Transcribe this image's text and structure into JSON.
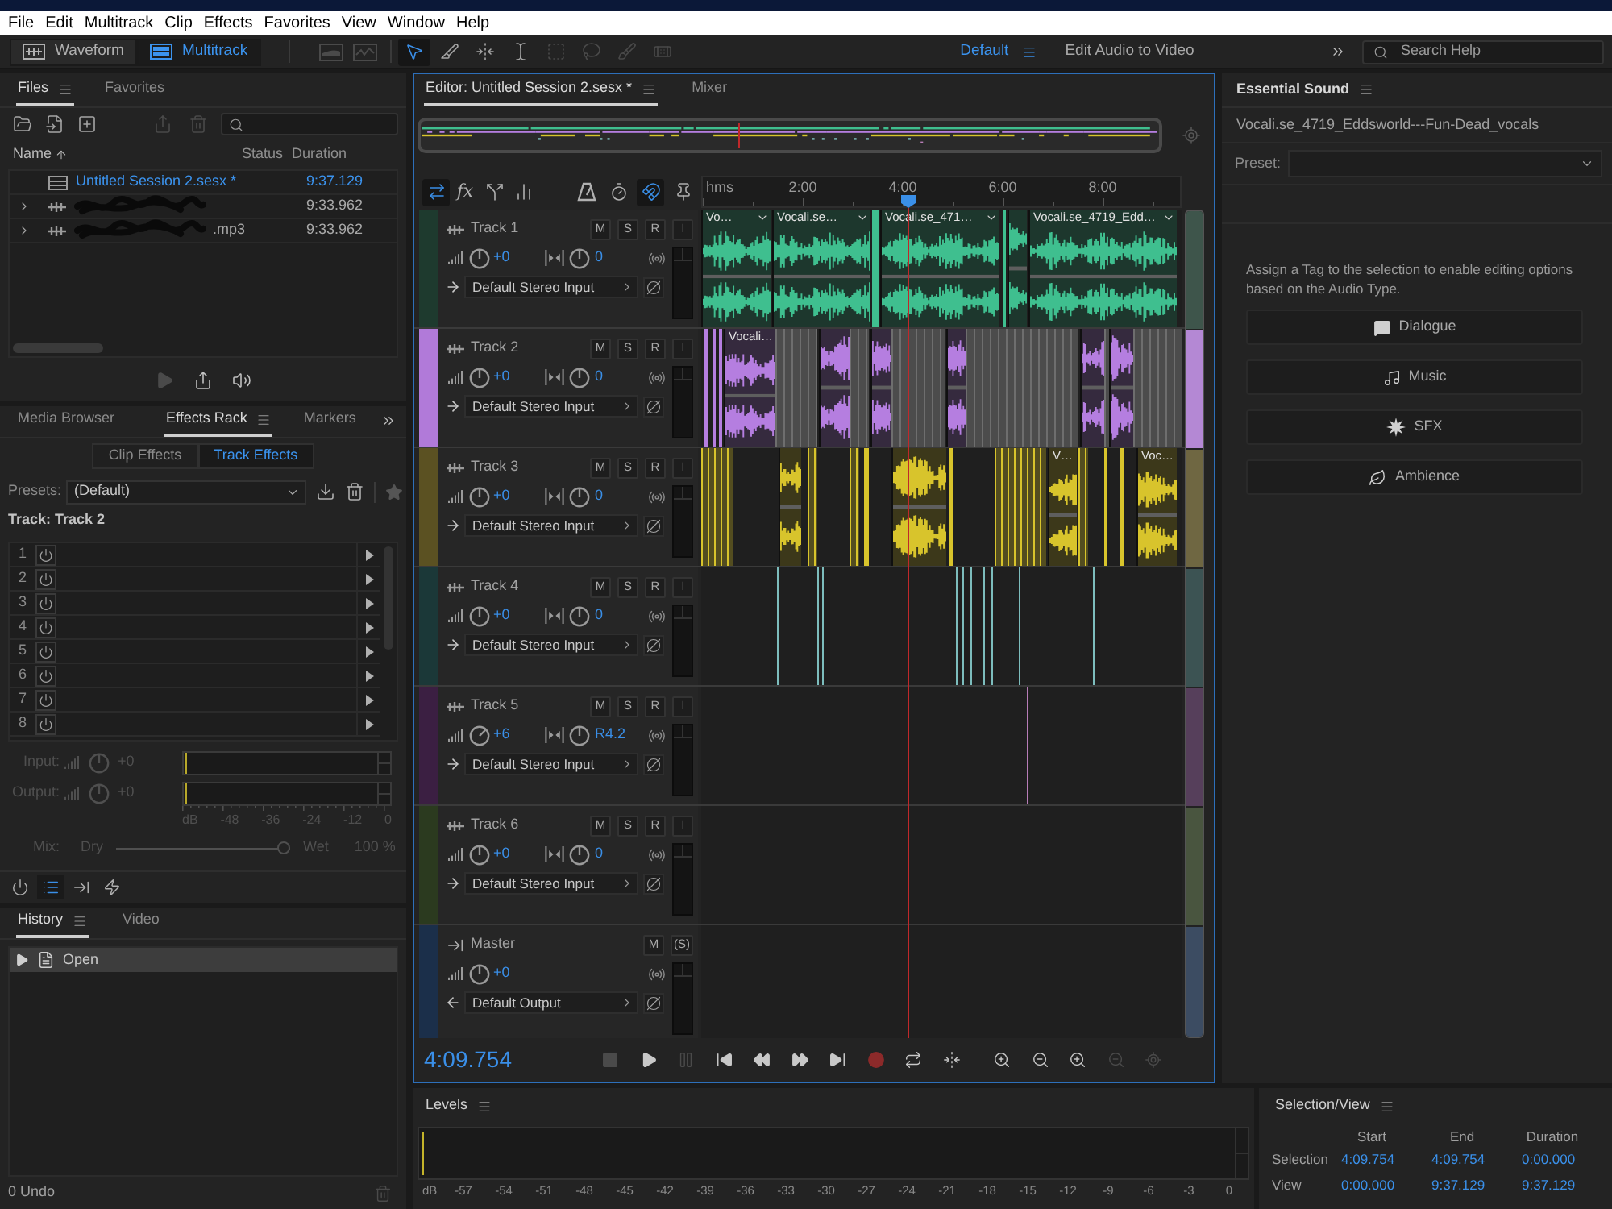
{
  "menu_bar": [
    "File",
    "Edit",
    "Multitrack",
    "Clip",
    "Effects",
    "Favorites",
    "View",
    "Window",
    "Help"
  ],
  "toolbar": {
    "views": [
      {
        "kind": "waveform",
        "label": "Waveform",
        "selected": false
      },
      {
        "kind": "multitrack",
        "label": "Multitrack",
        "selected": true
      }
    ],
    "display_tools": [
      {
        "kind": "spectral-frequency",
        "disabled": true
      },
      {
        "kind": "spectral-pitch",
        "disabled": true
      }
    ],
    "tools": [
      {
        "kind": "move",
        "selected": true,
        "disabled": false
      },
      {
        "kind": "razor",
        "selected": false,
        "disabled": false
      },
      {
        "kind": "slip",
        "selected": false,
        "disabled": false
      },
      {
        "kind": "time-selection",
        "selected": false,
        "disabled": false
      },
      {
        "kind": "marquee",
        "selected": false,
        "disabled": true
      },
      {
        "kind": "lasso",
        "selected": false,
        "disabled": true
      },
      {
        "kind": "brush",
        "selected": false,
        "disabled": true
      },
      {
        "kind": "healing",
        "selected": false,
        "disabled": true
      }
    ],
    "workspaces": [
      {
        "label": "Default",
        "selected": true
      },
      {
        "label": "Edit Audio to Video",
        "selected": false
      }
    ],
    "search": {
      "placeholder": "Search Help"
    }
  },
  "files_panel": {
    "tabs": [
      {
        "label": "Files",
        "selected": true
      },
      {
        "label": "Favorites",
        "selected": false
      }
    ],
    "tools": [
      {
        "kind": "open",
        "disabled": false
      },
      {
        "kind": "import",
        "disabled": false
      },
      {
        "kind": "new",
        "disabled": false
      },
      {
        "kind": "export",
        "disabled": true
      },
      {
        "kind": "delete",
        "disabled": true
      }
    ],
    "columns": [
      {
        "label": "Name",
        "sorted": true
      },
      {
        "label": "Status",
        "sorted": false
      },
      {
        "label": "Duration",
        "sorted": false
      }
    ],
    "rows": [
      {
        "kind": "session",
        "name": "Untitled Session 2.sesx *",
        "duration": "9:37.129",
        "open": true,
        "expandable": false,
        "redacted": false
      },
      {
        "kind": "audio",
        "duration": "9:33.962",
        "open": false,
        "expandable": true,
        "redacted": true
      },
      {
        "kind": "audio",
        "name": ".mp3",
        "duration": "9:33.962",
        "open": false,
        "expandable": true,
        "redacted": true
      }
    ],
    "footer_tools": [
      {
        "kind": "play",
        "disabled": true
      },
      {
        "kind": "export",
        "disabled": false
      },
      {
        "kind": "autoplay",
        "disabled": false
      }
    ]
  },
  "effects_rack": {
    "tabs": [
      {
        "label": "Media Browser",
        "selected": false
      },
      {
        "label": "Effects Rack",
        "selected": true
      },
      {
        "label": "Markers",
        "selected": false
      }
    ],
    "modes": [
      {
        "label": "Clip Effects",
        "selected": false
      },
      {
        "label": "Track Effects",
        "selected": true
      }
    ],
    "presets": {
      "label": "Presets:",
      "value": "(Default)"
    },
    "target": "Track: Track 2",
    "slots": [
      "1",
      "2",
      "3",
      "4",
      "5",
      "6",
      "7",
      "8"
    ],
    "io": {
      "disabled": true,
      "input": {
        "label": "Input:",
        "value": "+0"
      },
      "output": {
        "label": "Output:",
        "value": "+0"
      },
      "scale": [
        "dB",
        "-48",
        "-36",
        "-24",
        "-12",
        "0"
      ],
      "mix": {
        "label": "Mix:",
        "dry": "Dry",
        "wet": "Wet",
        "value": "100 %",
        "level": 1
      }
    },
    "footer_tools": [
      {
        "kind": "power",
        "selected": false
      },
      {
        "kind": "list",
        "selected": true
      },
      {
        "kind": "insert",
        "selected": false
      },
      {
        "kind": "process",
        "selected": false
      }
    ]
  },
  "history_panel": {
    "tabs": [
      {
        "label": "History",
        "selected": true
      },
      {
        "label": "Video",
        "selected": false
      }
    ],
    "items": [
      {
        "label": "Open",
        "selected": true
      }
    ],
    "status": "0 Undo"
  },
  "editor": {
    "tabs": [
      {
        "label": "Editor: Untitled Session 2.sesx *",
        "selected": true
      },
      {
        "label": "Mixer",
        "selected": false
      }
    ],
    "toolbar_left": [
      {
        "kind": "inputs-outputs",
        "selected": true
      },
      {
        "kind": "effects",
        "label": "fx",
        "selected": false
      },
      {
        "kind": "sends",
        "selected": false
      },
      {
        "kind": "eq",
        "selected": false
      }
    ],
    "toolbar_right": [
      {
        "kind": "metronome",
        "selected": false
      },
      {
        "kind": "time-stretch",
        "selected": false
      },
      {
        "kind": "snap",
        "selected": true
      },
      {
        "kind": "marker",
        "selected": false
      }
    ],
    "ruler": {
      "unit": "hms",
      "labels": [
        "2:00",
        "4:00",
        "6:00",
        "8:00"
      ]
    },
    "tracks": [
      {
        "kind": "audio",
        "name": "Track 1",
        "color": "#1e3a2e",
        "buttons": [
          {
            "label": "M",
            "disabled": false
          },
          {
            "label": "S",
            "disabled": false
          },
          {
            "label": "R",
            "disabled": false
          },
          {
            "label": "I",
            "disabled": true
          }
        ],
        "volume": {
          "value": "+0",
          "turned": false
        },
        "pan": {
          "value": "0",
          "turned": false
        },
        "io": "Default Stereo Input",
        "clips": [
          "Vo…",
          "Vocali.se…",
          "Vocali.se_471…",
          "Vocali.se_4719_Edd…"
        ]
      },
      {
        "kind": "audio",
        "name": "Track 2",
        "color": "#b17ad9",
        "buttons": [
          {
            "label": "M",
            "disabled": false
          },
          {
            "label": "S",
            "disabled": false
          },
          {
            "label": "R",
            "disabled": false
          },
          {
            "label": "I",
            "disabled": true
          }
        ],
        "volume": {
          "value": "+0",
          "turned": false
        },
        "pan": {
          "value": "0",
          "turned": false
        },
        "io": "Default Stereo Input",
        "clips": [
          "Vocali…"
        ]
      },
      {
        "kind": "audio",
        "name": "Track 3",
        "color": "#5b5122",
        "buttons": [
          {
            "label": "M",
            "disabled": false
          },
          {
            "label": "S",
            "disabled": false
          },
          {
            "label": "R",
            "disabled": false
          },
          {
            "label": "I",
            "disabled": true
          }
        ],
        "volume": {
          "value": "+0",
          "turned": false
        },
        "pan": {
          "value": "0",
          "turned": false
        },
        "io": "Default Stereo Input",
        "clips": [
          "V…",
          "Voc…"
        ]
      },
      {
        "kind": "audio",
        "name": "Track 4",
        "color": "#1b3838",
        "buttons": [
          {
            "label": "M",
            "disabled": false
          },
          {
            "label": "S",
            "disabled": false
          },
          {
            "label": "R",
            "disabled": false
          },
          {
            "label": "I",
            "disabled": true
          }
        ],
        "volume": {
          "value": "+0",
          "turned": false
        },
        "pan": {
          "value": "0",
          "turned": false
        },
        "io": "Default Stereo Input"
      },
      {
        "kind": "audio",
        "name": "Track 5",
        "color": "#3b1f42",
        "buttons": [
          {
            "label": "M",
            "disabled": false
          },
          {
            "label": "S",
            "disabled": false
          },
          {
            "label": "R",
            "disabled": false
          },
          {
            "label": "I",
            "disabled": true
          }
        ],
        "volume": {
          "value": "+6",
          "turned": true
        },
        "pan": {
          "value": "R4.2",
          "turned": false
        },
        "io": "Default Stereo Input"
      },
      {
        "kind": "audio",
        "name": "Track 6",
        "color": "#2b3a1f",
        "buttons": [
          {
            "label": "M",
            "disabled": false
          },
          {
            "label": "S",
            "disabled": false
          },
          {
            "label": "R",
            "disabled": false
          },
          {
            "label": "I",
            "disabled": true
          }
        ],
        "volume": {
          "value": "+0",
          "turned": false
        },
        "pan": {
          "value": "0",
          "turned": false
        },
        "io": "Default Stereo Input"
      },
      {
        "kind": "master",
        "name": "Master",
        "color": "#1b2f4a",
        "buttons": [
          {
            "label": "M",
            "disabled": false
          },
          {
            "label": "(S)",
            "disabled": false
          }
        ],
        "volume": {
          "value": "+0",
          "turned": false
        },
        "io": "Default Output"
      }
    ],
    "transport": {
      "time": "4:09.754",
      "buttons": [
        {
          "kind": "stop",
          "disabled": true
        },
        {
          "kind": "play",
          "disabled": false
        },
        {
          "kind": "pause",
          "disabled": true
        },
        {
          "kind": "to-start",
          "disabled": false
        },
        {
          "kind": "rewind",
          "disabled": false
        },
        {
          "kind": "fast-forward",
          "disabled": false
        },
        {
          "kind": "to-end",
          "disabled": false
        },
        {
          "kind": "record",
          "disabled": false
        },
        {
          "kind": "loop",
          "disabled": false
        },
        {
          "kind": "skip-selection",
          "disabled": false
        },
        {
          "kind": "zoom-in-amplitude",
          "disabled": false
        },
        {
          "kind": "zoom-out-amplitude",
          "disabled": false
        },
        {
          "kind": "zoom-in-time",
          "disabled": false
        },
        {
          "kind": "zoom-out-time",
          "disabled": true
        },
        {
          "kind": "zoom-full",
          "disabled": true
        }
      ]
    }
  },
  "essential_sound": {
    "title": "Essential Sound",
    "file": "Vocali.se_4719_Eddsworld---Fun-Dead_vocals",
    "preset": {
      "label": "Preset:"
    },
    "hint": "Assign a Tag to the selection to enable editing options based on the Audio Type.",
    "tags": [
      {
        "kind": "dialogue",
        "label": "Dialogue"
      },
      {
        "kind": "music",
        "label": "Music"
      },
      {
        "kind": "sfx",
        "label": "SFX"
      },
      {
        "kind": "ambience",
        "label": "Ambience"
      }
    ]
  },
  "levels_panel": {
    "title": "Levels",
    "scale": [
      "dB",
      "-57",
      "-54",
      "-51",
      "-48",
      "-45",
      "-42",
      "-39",
      "-36",
      "-33",
      "-30",
      "-27",
      "-24",
      "-21",
      "-18",
      "-15",
      "-12",
      "-9",
      "-6",
      "-3",
      "0"
    ]
  },
  "selection_view": {
    "title": "Selection/View",
    "columns": [
      "Start",
      "End",
      "Duration"
    ],
    "rows": [
      {
        "label": "Selection",
        "values": [
          "4:09.754",
          "4:09.754",
          "0:00.000"
        ]
      },
      {
        "label": "View",
        "values": [
          "0:00.000",
          "9:37.129",
          "9:37.129"
        ]
      }
    ]
  }
}
